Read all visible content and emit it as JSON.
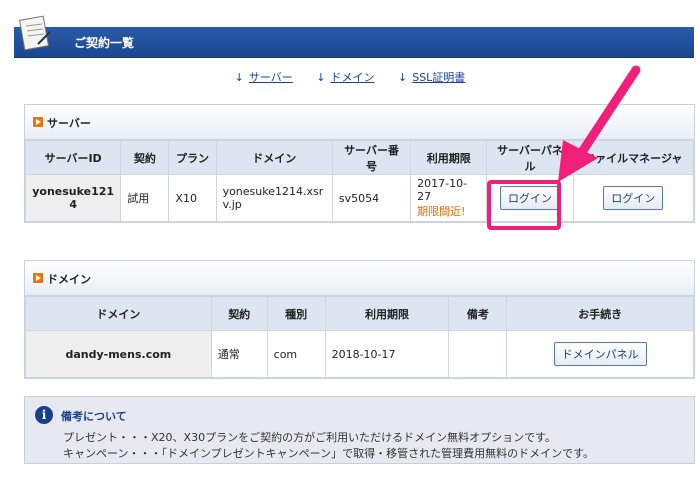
{
  "header": {
    "title": "ご契約一覧",
    "icon": "contract-document-icon"
  },
  "nav": [
    {
      "label": "サーバー"
    },
    {
      "label": "ドメイン"
    },
    {
      "label": "SSL証明書"
    }
  ],
  "server_panel": {
    "title": "サーバー",
    "columns": [
      "サーバーID",
      "契約",
      "プラン",
      "ドメイン",
      "サーバー番号",
      "利用期限",
      "サーバーパネル",
      "ファイルマネージャ"
    ],
    "row": {
      "id": "yonesuke1214",
      "contract": "試用",
      "plan": "X10",
      "domain": "yonesuke1214.xsrv.jp",
      "server_no": "sv5054",
      "expiry": "2017-10-27",
      "expiry_warning": "期限間近!",
      "panel_button": "ログイン",
      "fm_button": "ログイン"
    }
  },
  "domain_panel": {
    "title": "ドメイン",
    "columns": [
      "ドメイン",
      "契約",
      "種別",
      "利用期限",
      "備考",
      "お手続き"
    ],
    "row": {
      "domain": "dandy-mens.com",
      "contract": "通常",
      "type": "com",
      "expiry": "2018-10-17",
      "note": "",
      "action_button": "ドメインパネル"
    }
  },
  "notes": {
    "title": "備考について",
    "lines": [
      "プレゼント・・・X20、X30プランをご契約の方がご利用いただけるドメイン無料オプションです。",
      "キャンペーン・・・「ドメインプレゼントキャンペーン」で取得・移管された管理費用無料のドメインです。"
    ]
  },
  "colors": {
    "header": "#1c4690",
    "highlight": "#f0207a",
    "warning": "#ef6a00",
    "accent": "#e8760f"
  }
}
